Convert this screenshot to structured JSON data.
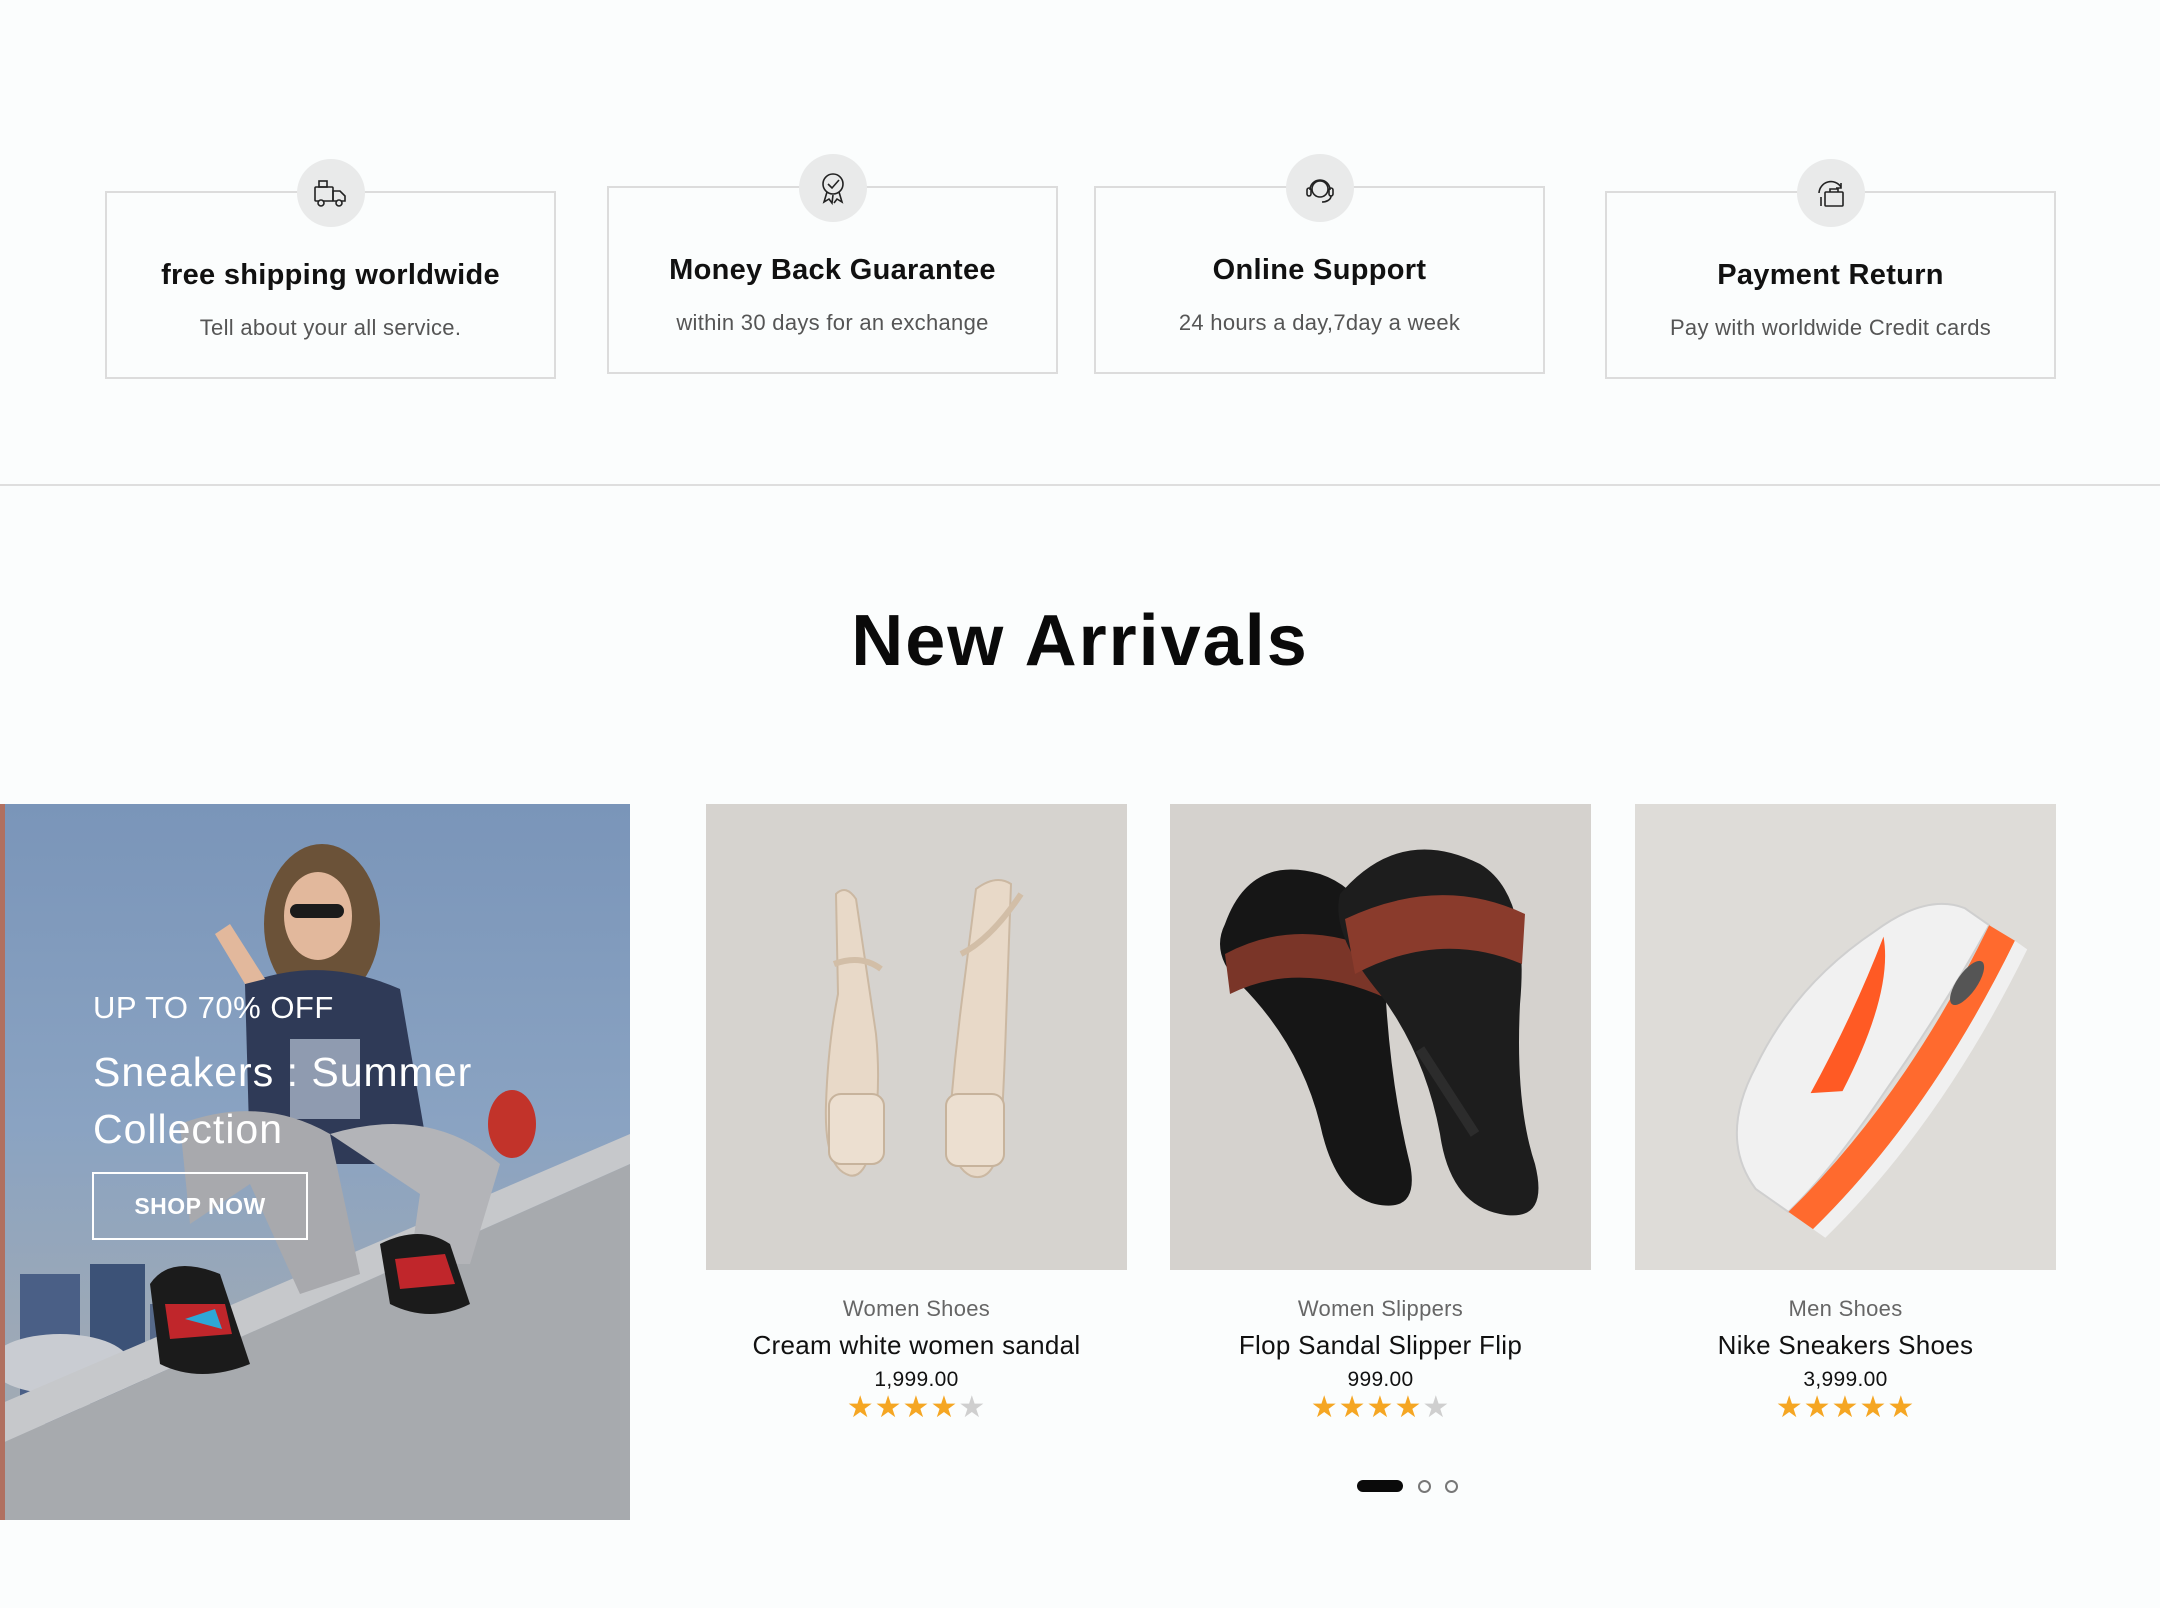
{
  "features": [
    {
      "icon": "truck-icon",
      "title": "free shipping worldwide",
      "subtitle": "Tell about your all service."
    },
    {
      "icon": "award-badge-icon",
      "title": "Money Back Guarantee",
      "subtitle": "within 30 days for an exchange"
    },
    {
      "icon": "support-headset-icon",
      "title": "Online Support",
      "subtitle": "24 hours a day,7day a week"
    },
    {
      "icon": "payment-bag-icon",
      "title": "Payment Return",
      "subtitle": "Pay with worldwide  Credit cards"
    }
  ],
  "section": {
    "title": "New Arrivals"
  },
  "promo": {
    "kicker": "UP TO 70% OFF",
    "title": "Sneakers : Summer Collection",
    "button_label": "SHOP NOW"
  },
  "products": [
    {
      "category": "Women Shoes",
      "name": "Cream white women sandal",
      "price": "1,999.00",
      "rating": 4,
      "max_rating": 5
    },
    {
      "category": "Women Slippers",
      "name": "Flop Sandal Slipper Flip",
      "price": "999.00",
      "rating": 4,
      "max_rating": 5
    },
    {
      "category": "Men Shoes",
      "name": "Nike Sneakers Shoes",
      "price": "3,999.00",
      "rating": 5,
      "max_rating": 5
    }
  ],
  "pagination": {
    "pages": 3,
    "active_index": 0
  },
  "colors": {
    "star": "#f5a623",
    "star_empty": "#cfcfcf",
    "background": "#fbfdfd",
    "border": "#dcdcdc"
  }
}
